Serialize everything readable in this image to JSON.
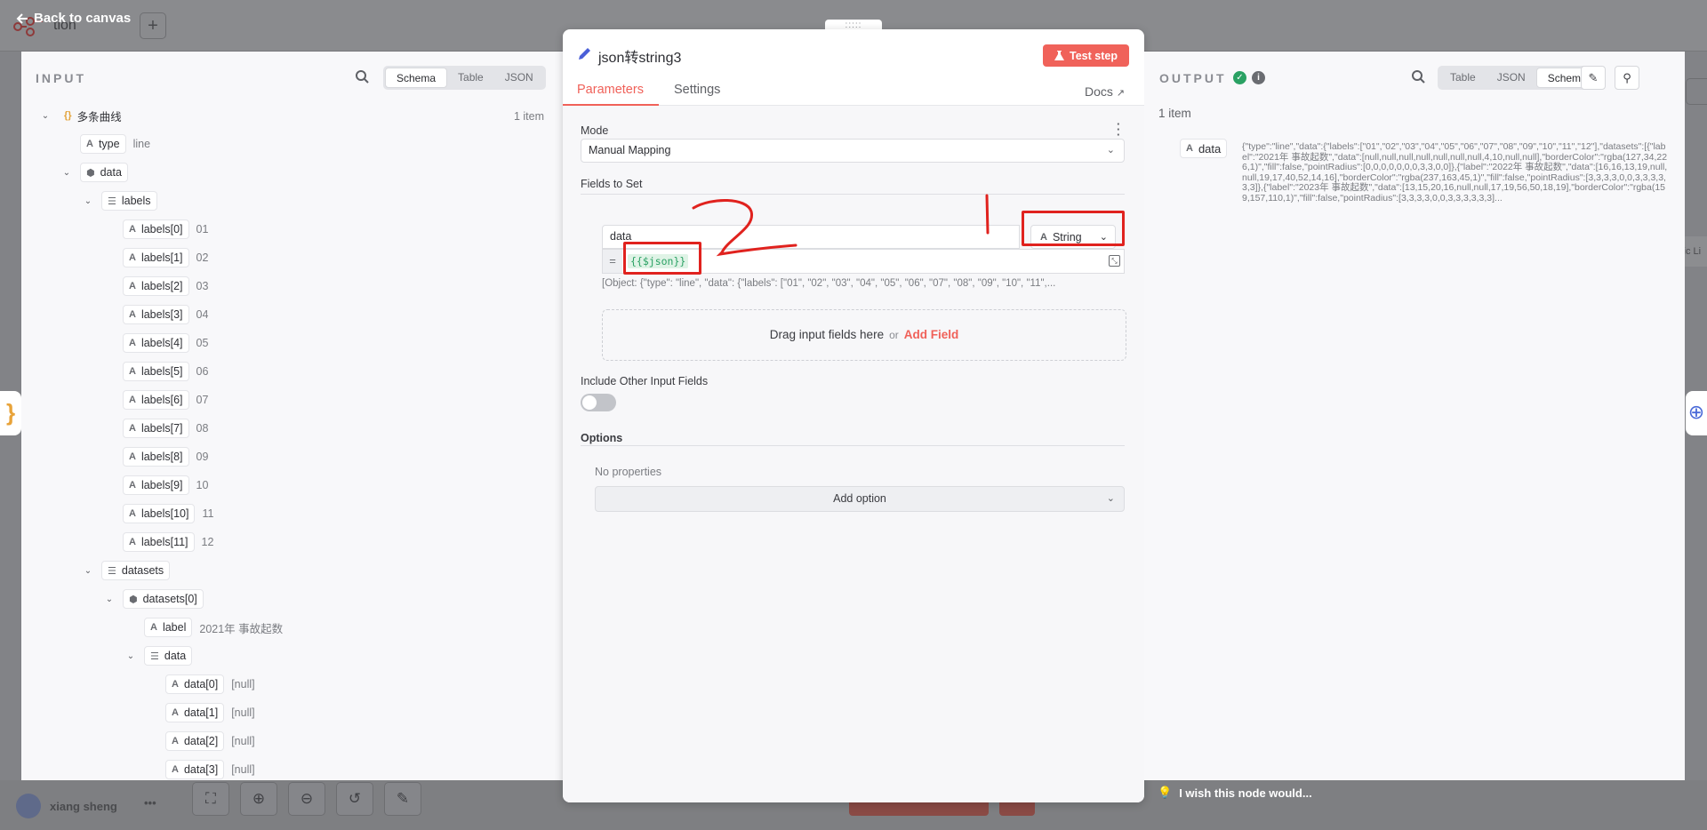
{
  "topbar": {
    "back_label": "Back to canvas",
    "workflow_fragment": "tion",
    "plus": "+"
  },
  "bottombar": {
    "user_name": "xiang sheng",
    "menu_dots": "•••",
    "wish_label": "I wish this node would..."
  },
  "input": {
    "title": "INPUT",
    "views": [
      "Schema",
      "Table",
      "JSON"
    ],
    "active_view": "Schema",
    "item_count": "1 item",
    "tree": [
      {
        "key": "多条曲线",
        "type": "object",
        "value": "",
        "depth": 0
      },
      {
        "key": "type",
        "type": "string",
        "value": "line",
        "depth": 1
      },
      {
        "key": "data",
        "type": "object",
        "value": "",
        "depth": 1
      },
      {
        "key": "labels",
        "type": "array",
        "value": "",
        "depth": 2
      },
      {
        "key": "labels[0]",
        "type": "string",
        "value": "01",
        "depth": 3
      },
      {
        "key": "labels[1]",
        "type": "string",
        "value": "02",
        "depth": 3
      },
      {
        "key": "labels[2]",
        "type": "string",
        "value": "03",
        "depth": 3
      },
      {
        "key": "labels[3]",
        "type": "string",
        "value": "04",
        "depth": 3
      },
      {
        "key": "labels[4]",
        "type": "string",
        "value": "05",
        "depth": 3
      },
      {
        "key": "labels[5]",
        "type": "string",
        "value": "06",
        "depth": 3
      },
      {
        "key": "labels[6]",
        "type": "string",
        "value": "07",
        "depth": 3
      },
      {
        "key": "labels[7]",
        "type": "string",
        "value": "08",
        "depth": 3
      },
      {
        "key": "labels[8]",
        "type": "string",
        "value": "09",
        "depth": 3
      },
      {
        "key": "labels[9]",
        "type": "string",
        "value": "10",
        "depth": 3
      },
      {
        "key": "labels[10]",
        "type": "string",
        "value": "11",
        "depth": 3
      },
      {
        "key": "labels[11]",
        "type": "string",
        "value": "12",
        "depth": 3
      },
      {
        "key": "datasets",
        "type": "array",
        "value": "",
        "depth": 2
      },
      {
        "key": "datasets[0]",
        "type": "object",
        "value": "",
        "depth": 3
      },
      {
        "key": "label",
        "type": "string",
        "value": "2021年 事故起数",
        "depth": 4
      },
      {
        "key": "data",
        "type": "array",
        "value": "",
        "depth": 4
      },
      {
        "key": "data[0]",
        "type": "string",
        "value": "[null]",
        "depth": 5
      },
      {
        "key": "data[1]",
        "type": "string",
        "value": "[null]",
        "depth": 5
      },
      {
        "key": "data[2]",
        "type": "string",
        "value": "[null]",
        "depth": 5
      },
      {
        "key": "data[3]",
        "type": "string",
        "value": "[null]",
        "depth": 5
      }
    ]
  },
  "node": {
    "name": "json转string3",
    "test_label": "Test step",
    "tabs": [
      "Parameters",
      "Settings"
    ],
    "active_tab": "Parameters",
    "docs_label": "Docs",
    "mode_label": "Mode",
    "mode_value": "Manual Mapping",
    "fields_label": "Fields to Set",
    "field": {
      "name": "data",
      "type": "String",
      "expression": "{{$json}}",
      "preview": "[Object: {\"type\": \"line\", \"data\": {\"labels\": [\"01\", \"02\", \"03\", \"04\", \"05\", \"06\", \"07\", \"08\", \"09\", \"10\", \"11\",..."
    },
    "drop_text": "Drag input fields here",
    "drop_or": "or",
    "add_field": "Add Field",
    "include_label": "Include Other Input Fields",
    "include_enabled": false,
    "options_label": "Options",
    "no_props": "No properties",
    "add_option": "Add option"
  },
  "output": {
    "title": "OUTPUT",
    "views": [
      "Table",
      "JSON",
      "Schema"
    ],
    "active_view": "Schema",
    "item_count": "1 item",
    "field_key": "data",
    "field_value": "{\"type\":\"line\",\"data\":{\"labels\":[\"01\",\"02\",\"03\",\"04\",\"05\",\"06\",\"07\",\"08\",\"09\",\"10\",\"11\",\"12\"],\"datasets\":[{\"label\":\"2021年 事故起数\",\"data\":[null,null,null,null,null,null,null,4,10,null,null],\"borderColor\":\"rgba(127,34,226,1)\",\"fill\":false,\"pointRadius\":[0,0,0,0,0,0,0,3,3,0,0]},{\"label\":\"2022年 事故起数\",\"data\":[16,16,13,19,null,null,19,17,40,52,14,16],\"borderColor\":\"rgba(237,163,45,1)\",\"fill\":false,\"pointRadius\":[3,3,3,3,0,0,3,3,3,3,3,3]},{\"label\":\"2023年 事故起数\",\"data\":[13,15,20,16,null,null,17,19,56,50,18,19],\"borderColor\":\"rgba(159,157,110,1)\",\"fill\":false,\"pointRadius\":[3,3,3,3,0,0,3,3,3,3,3,3]..."
  },
  "annotations": {
    "mark_1": "1",
    "mark_2": "2",
    "color": "#e0221e"
  },
  "colors": {
    "accent": "#f06159",
    "success": "#2aa163",
    "object_icon": "#e3a33a"
  }
}
